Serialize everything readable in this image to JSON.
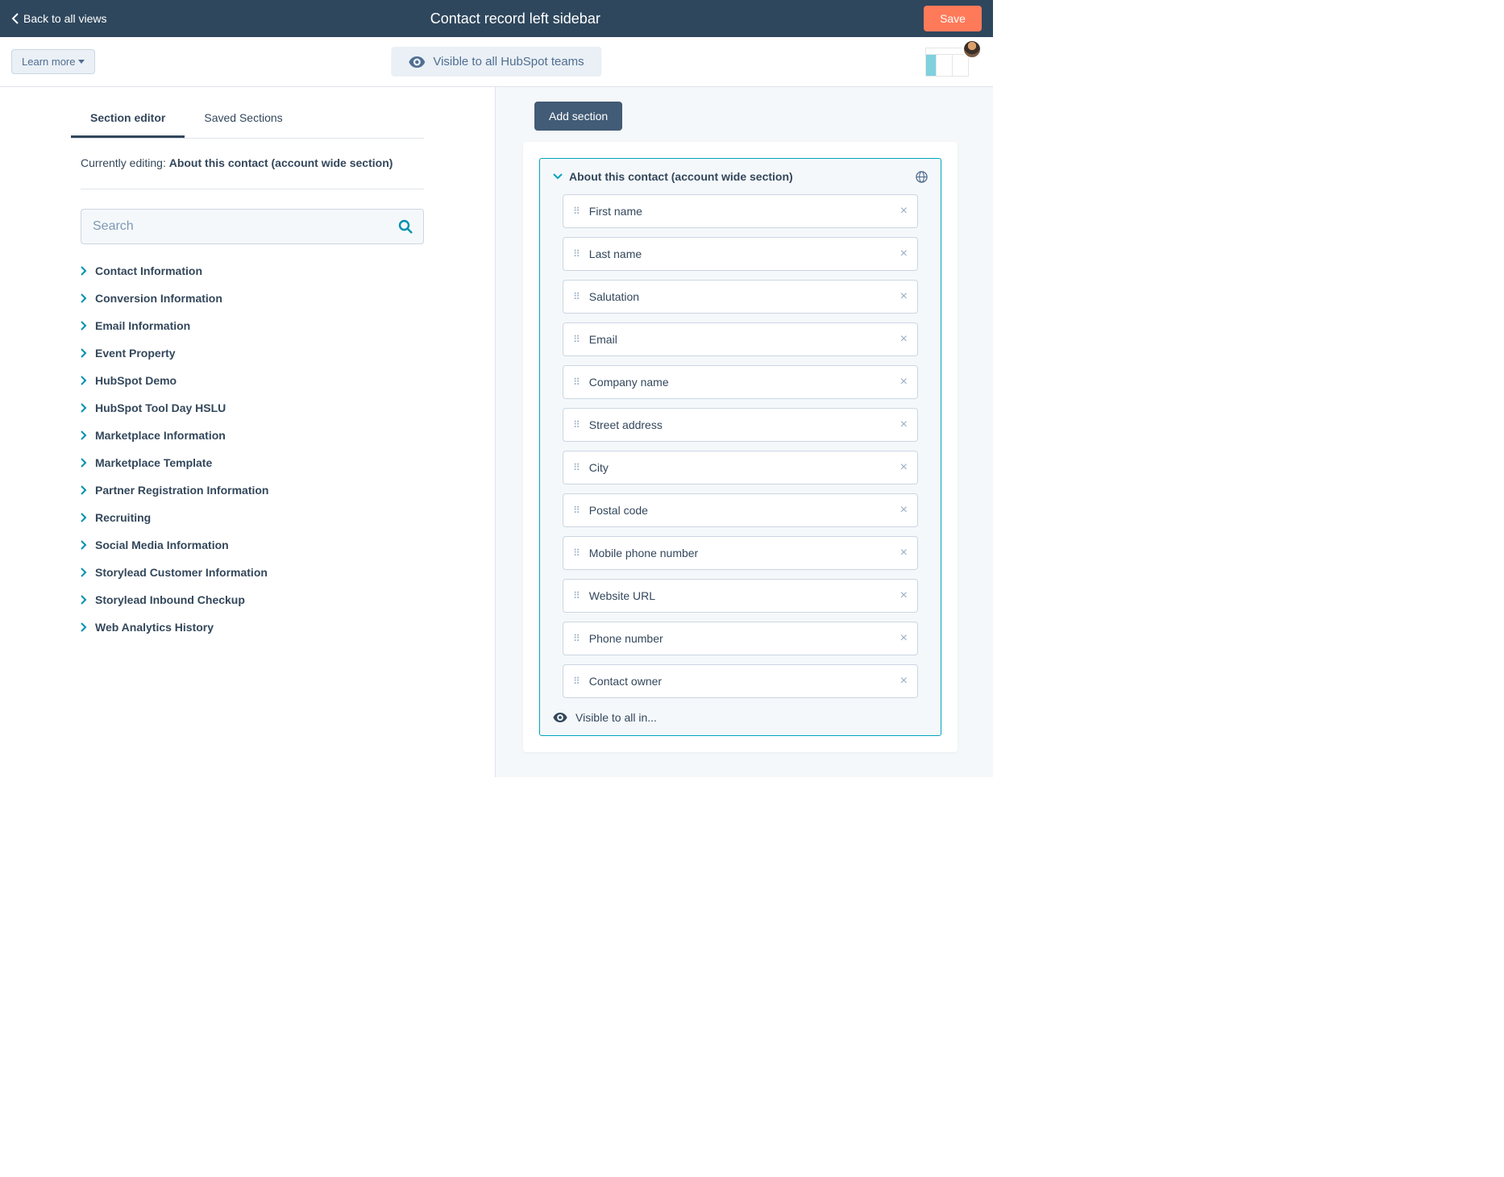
{
  "topbar": {
    "back_label": "Back to all views",
    "title": "Contact record left sidebar",
    "save_label": "Save"
  },
  "subbar": {
    "learn_more_label": "Learn more",
    "visibility_label": "Visible to all HubSpot teams"
  },
  "tabs": {
    "section_editor": "Section editor",
    "saved_sections": "Saved Sections"
  },
  "editing": {
    "prefix": "Currently editing: ",
    "name": "About this contact (account wide section)"
  },
  "search": {
    "placeholder": "Search"
  },
  "categories": [
    {
      "label": "Contact Information"
    },
    {
      "label": "Conversion Information"
    },
    {
      "label": "Email Information"
    },
    {
      "label": "Event Property"
    },
    {
      "label": "HubSpot Demo"
    },
    {
      "label": "HubSpot Tool Day HSLU"
    },
    {
      "label": "Marketplace Information"
    },
    {
      "label": "Marketplace Template"
    },
    {
      "label": "Partner Registration Information"
    },
    {
      "label": "Recruiting"
    },
    {
      "label": "Social Media Information"
    },
    {
      "label": "Storylead Customer Information"
    },
    {
      "label": "Storylead Inbound Checkup"
    },
    {
      "label": "Web Analytics History"
    }
  ],
  "right": {
    "add_section_label": "Add section",
    "section_title": "About this contact (account wide section)",
    "footer_text": "Visible to all in...",
    "fields": [
      {
        "label": "First name"
      },
      {
        "label": "Last name"
      },
      {
        "label": "Salutation"
      },
      {
        "label": "Email"
      },
      {
        "label": "Company name"
      },
      {
        "label": "Street address"
      },
      {
        "label": "City"
      },
      {
        "label": "Postal code"
      },
      {
        "label": "Mobile phone number"
      },
      {
        "label": "Website URL"
      },
      {
        "label": "Phone number"
      },
      {
        "label": "Contact owner"
      }
    ]
  }
}
